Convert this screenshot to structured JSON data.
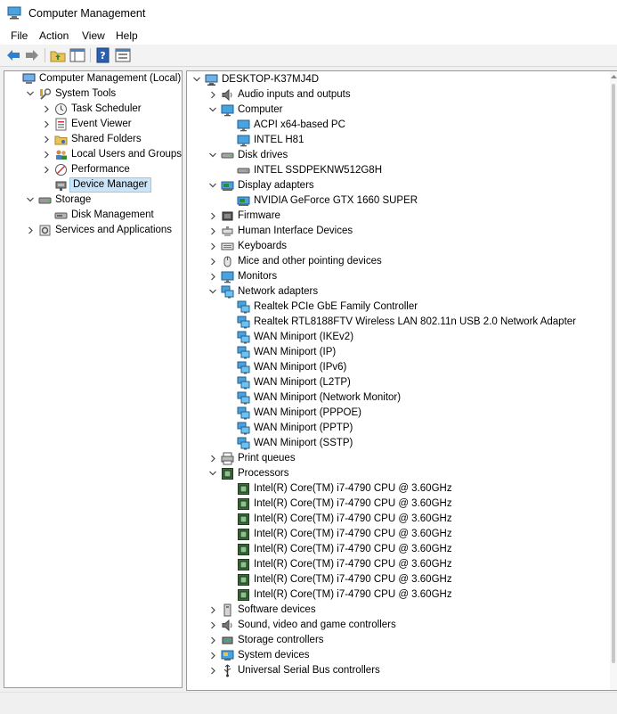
{
  "window": {
    "title": "Computer Management"
  },
  "menu": [
    "File",
    "Action",
    "View",
    "Help"
  ],
  "toolbar": [
    {
      "name": "back-arrow-icon"
    },
    {
      "name": "forward-arrow-icon"
    },
    {
      "name": "up-folder-icon"
    },
    {
      "name": "show-hide-tree-icon"
    },
    {
      "name": "help-icon"
    },
    {
      "name": "properties-icon"
    }
  ],
  "left_tree": [
    {
      "label": "Computer Management (Local)",
      "level": 0,
      "toggle": "none",
      "icon": "computer-management-icon"
    },
    {
      "label": "System Tools",
      "level": 1,
      "toggle": "expanded",
      "icon": "system-tools-icon"
    },
    {
      "label": "Task Scheduler",
      "level": 2,
      "toggle": "collapsed",
      "icon": "clock-icon"
    },
    {
      "label": "Event Viewer",
      "level": 2,
      "toggle": "collapsed",
      "icon": "event-viewer-icon"
    },
    {
      "label": "Shared Folders",
      "level": 2,
      "toggle": "collapsed",
      "icon": "shared-folder-icon"
    },
    {
      "label": "Local Users and Groups",
      "level": 2,
      "toggle": "collapsed",
      "icon": "users-icon"
    },
    {
      "label": "Performance",
      "level": 2,
      "toggle": "collapsed",
      "icon": "performance-icon"
    },
    {
      "label": "Device Manager",
      "level": 2,
      "toggle": "none",
      "icon": "device-manager-icon",
      "selected": true
    },
    {
      "label": "Storage",
      "level": 1,
      "toggle": "expanded",
      "icon": "storage-icon"
    },
    {
      "label": "Disk Management",
      "level": 2,
      "toggle": "none",
      "icon": "disk-management-icon"
    },
    {
      "label": "Services and Applications",
      "level": 1,
      "toggle": "collapsed",
      "icon": "services-icon"
    }
  ],
  "device_tree": [
    {
      "label": "DESKTOP-K37MJ4D",
      "level": 0,
      "toggle": "expanded",
      "icon": "computer-icon"
    },
    {
      "label": "Audio inputs and outputs",
      "level": 1,
      "toggle": "collapsed",
      "icon": "speaker-icon"
    },
    {
      "label": "Computer",
      "level": 1,
      "toggle": "expanded",
      "icon": "monitor-icon"
    },
    {
      "label": "ACPI x64-based PC",
      "level": 2,
      "toggle": "none",
      "icon": "monitor-icon"
    },
    {
      "label": "INTEL H81",
      "level": 2,
      "toggle": "none",
      "icon": "monitor-icon"
    },
    {
      "label": "Disk drives",
      "level": 1,
      "toggle": "expanded",
      "icon": "disk-drive-icon"
    },
    {
      "label": "INTEL SSDPEKNW512G8H",
      "level": 2,
      "toggle": "none",
      "icon": "disk-drive-icon"
    },
    {
      "label": "Display adapters",
      "level": 1,
      "toggle": "expanded",
      "icon": "display-adapter-icon"
    },
    {
      "label": "NVIDIA GeForce GTX 1660 SUPER",
      "level": 2,
      "toggle": "none",
      "icon": "display-adapter-icon"
    },
    {
      "label": "Firmware",
      "level": 1,
      "toggle": "collapsed",
      "icon": "firmware-icon"
    },
    {
      "label": "Human Interface Devices",
      "level": 1,
      "toggle": "collapsed",
      "icon": "hid-icon"
    },
    {
      "label": "Keyboards",
      "level": 1,
      "toggle": "collapsed",
      "icon": "keyboard-icon"
    },
    {
      "label": "Mice and other pointing devices",
      "level": 1,
      "toggle": "collapsed",
      "icon": "mouse-icon"
    },
    {
      "label": "Monitors",
      "level": 1,
      "toggle": "collapsed",
      "icon": "monitor-icon"
    },
    {
      "label": "Network adapters",
      "level": 1,
      "toggle": "expanded",
      "icon": "network-icon"
    },
    {
      "label": "Realtek PCIe GbE Family Controller",
      "level": 2,
      "toggle": "none",
      "icon": "network-icon"
    },
    {
      "label": "Realtek RTL8188FTV Wireless LAN 802.11n USB 2.0 Network Adapter",
      "level": 2,
      "toggle": "none",
      "icon": "network-icon"
    },
    {
      "label": "WAN Miniport (IKEv2)",
      "level": 2,
      "toggle": "none",
      "icon": "network-icon"
    },
    {
      "label": "WAN Miniport (IP)",
      "level": 2,
      "toggle": "none",
      "icon": "network-icon"
    },
    {
      "label": "WAN Miniport (IPv6)",
      "level": 2,
      "toggle": "none",
      "icon": "network-icon"
    },
    {
      "label": "WAN Miniport (L2TP)",
      "level": 2,
      "toggle": "none",
      "icon": "network-icon"
    },
    {
      "label": "WAN Miniport (Network Monitor)",
      "level": 2,
      "toggle": "none",
      "icon": "network-icon"
    },
    {
      "label": "WAN Miniport (PPPOE)",
      "level": 2,
      "toggle": "none",
      "icon": "network-icon"
    },
    {
      "label": "WAN Miniport (PPTP)",
      "level": 2,
      "toggle": "none",
      "icon": "network-icon"
    },
    {
      "label": "WAN Miniport (SSTP)",
      "level": 2,
      "toggle": "none",
      "icon": "network-icon"
    },
    {
      "label": "Print queues",
      "level": 1,
      "toggle": "collapsed",
      "icon": "printer-icon"
    },
    {
      "label": "Processors",
      "level": 1,
      "toggle": "expanded",
      "icon": "processor-icon"
    },
    {
      "label": "Intel(R) Core(TM) i7-4790 CPU @ 3.60GHz",
      "level": 2,
      "toggle": "none",
      "icon": "processor-icon"
    },
    {
      "label": "Intel(R) Core(TM) i7-4790 CPU @ 3.60GHz",
      "level": 2,
      "toggle": "none",
      "icon": "processor-icon"
    },
    {
      "label": "Intel(R) Core(TM) i7-4790 CPU @ 3.60GHz",
      "level": 2,
      "toggle": "none",
      "icon": "processor-icon"
    },
    {
      "label": "Intel(R) Core(TM) i7-4790 CPU @ 3.60GHz",
      "level": 2,
      "toggle": "none",
      "icon": "processor-icon"
    },
    {
      "label": "Intel(R) Core(TM) i7-4790 CPU @ 3.60GHz",
      "level": 2,
      "toggle": "none",
      "icon": "processor-icon"
    },
    {
      "label": "Intel(R) Core(TM) i7-4790 CPU @ 3.60GHz",
      "level": 2,
      "toggle": "none",
      "icon": "processor-icon"
    },
    {
      "label": "Intel(R) Core(TM) i7-4790 CPU @ 3.60GHz",
      "level": 2,
      "toggle": "none",
      "icon": "processor-icon"
    },
    {
      "label": "Intel(R) Core(TM) i7-4790 CPU @ 3.60GHz",
      "level": 2,
      "toggle": "none",
      "icon": "processor-icon"
    },
    {
      "label": "Software devices",
      "level": 1,
      "toggle": "collapsed",
      "icon": "software-device-icon"
    },
    {
      "label": "Sound, video and game controllers",
      "level": 1,
      "toggle": "collapsed",
      "icon": "speaker-icon"
    },
    {
      "label": "Storage controllers",
      "level": 1,
      "toggle": "collapsed",
      "icon": "storage-controller-icon"
    },
    {
      "label": "System devices",
      "level": 1,
      "toggle": "collapsed",
      "icon": "system-device-icon"
    },
    {
      "label": "Universal Serial Bus controllers",
      "level": 1,
      "toggle": "collapsed",
      "icon": "usb-icon"
    }
  ]
}
